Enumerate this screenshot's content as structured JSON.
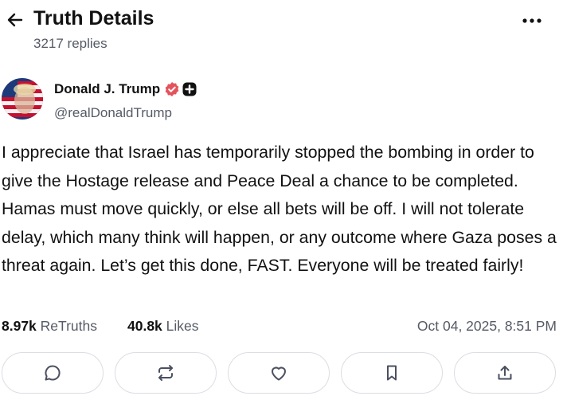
{
  "header": {
    "title": "Truth Details",
    "replies": "3217 replies",
    "back_icon": "arrow-left-icon",
    "more_icon": "more-horizontal-icon"
  },
  "author": {
    "display_name": "Donald J. Trump",
    "handle": "@realDonaldTrump",
    "verified_color": "#e4535d"
  },
  "post": {
    "text": "I appreciate that Israel has temporarily stopped the bombing in order to give the Hostage release and Peace Deal a chance to be completed. Hamas must move quickly, or else all bets will be off. I will not tolerate delay, which many think will happen, or any outcome where Gaza poses a threat again. Let’s get this done, FAST. Everyone will be treated fairly!"
  },
  "stats": {
    "retruths_count": "8.97k",
    "retruths_label": "ReTruths",
    "likes_count": "40.8k",
    "likes_label": "Likes",
    "timestamp": "Oct 04, 2025, 8:51 PM"
  },
  "actions": [
    {
      "icon": "comment-icon"
    },
    {
      "icon": "retruth-icon"
    },
    {
      "icon": "heart-icon"
    },
    {
      "icon": "bookmark-icon"
    },
    {
      "icon": "share-icon"
    }
  ]
}
